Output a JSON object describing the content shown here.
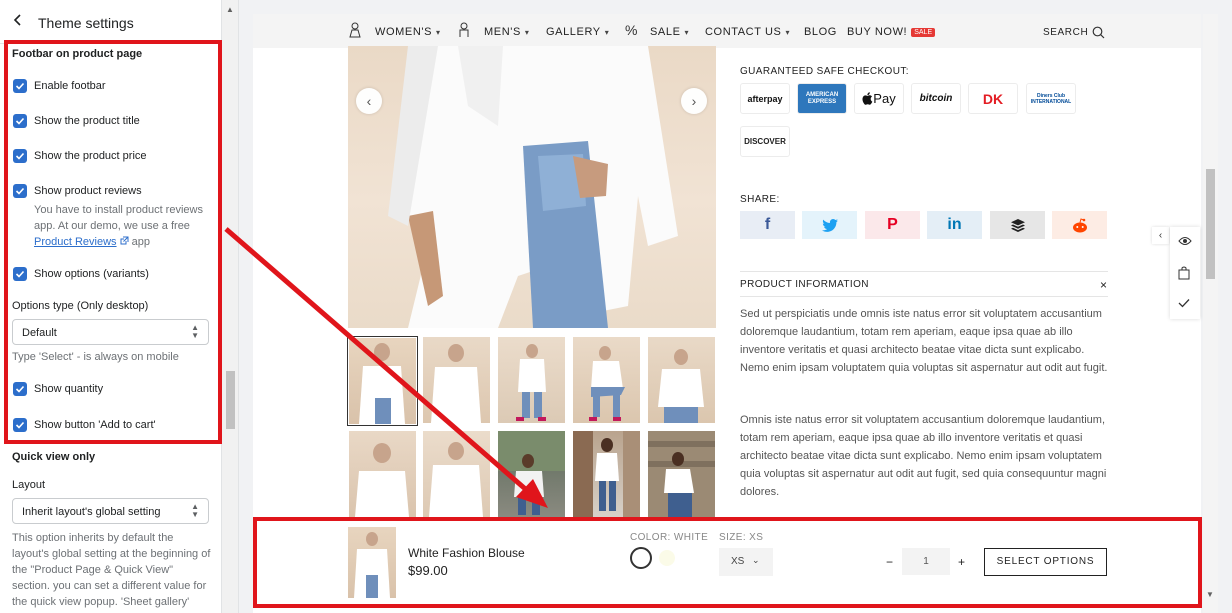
{
  "panel": {
    "back_icon": "chevron-left-icon",
    "title": "Theme settings",
    "footbar_section_title": "Footbar on product page",
    "checkboxes": {
      "enable_footbar": "Enable footbar",
      "show_title": "Show the product title",
      "show_price": "Show the product price",
      "show_reviews": "Show product reviews",
      "show_options": "Show options (variants)",
      "show_quantity": "Show quantity",
      "show_add_to_cart": "Show button 'Add to cart'"
    },
    "reviews_help_before": "You have to install product reviews app. At our demo, we use a free ",
    "reviews_help_link": "Product Reviews",
    "reviews_help_after": " app",
    "options_type_label": "Options type (Only desktop)",
    "options_type_value": "Default",
    "options_type_note": "Type 'Select' - is always on mobile",
    "quick_view_title": "Quick view only",
    "layout_label": "Layout",
    "layout_value": "Inherit layout's global setting",
    "layout_help": "This option inherits by default the layout's global setting at the beginning of the \"Product Page & Quick View\" section. you can set a different value for the quick view popup. 'Sheet gallery'"
  },
  "nav": {
    "womens": "WOMEN'S",
    "mens": "MEN'S",
    "gallery": "GALLERY",
    "sale": "SALE",
    "contact": "CONTACT US",
    "blog": "BLOG",
    "buy_now": "BUY NOW!",
    "sale_badge": "SALE",
    "search": "SEARCH"
  },
  "checkout_title": "GUARANTEED SAFE CHECKOUT:",
  "payments": [
    "afterpay",
    "AMERICAN EXPRESS",
    "Pay",
    "bitcoin",
    "DK",
    "Diners Club INTERNATIONAL",
    "DISCOVER"
  ],
  "share_title": "SHARE:",
  "share_icons": [
    "facebook-icon",
    "twitter-icon",
    "pinterest-icon",
    "linkedin-icon",
    "buffer-icon",
    "reddit-icon"
  ],
  "product_info_title": "PRODUCT INFORMATION",
  "product_info_close": "×",
  "paragraph1": "Sed ut perspiciatis unde omnis iste natus error sit voluptatem accusantium doloremque laudantium, totam rem aperiam, eaque ipsa quae ab illo inventore veritatis et quasi architecto beatae vitae dicta sunt explicabo. Nemo enim ipsam voluptatem quia voluptas sit aspernatur aut odit aut fugit.",
  "paragraph2": "Omnis iste natus error sit voluptatem accusantium doloremque laudantium, totam rem aperiam, eaque ipsa quae ab illo inventore veritatis et quasi architecto beatae vitae dicta sunt explicabo. Nemo enim ipsam voluptatem quia voluptas sit aspernatur aut odit aut fugit, sed quia consequuntur magni dolores.",
  "footbar": {
    "product_title": "White Fashion Blouse",
    "price": "$99.00",
    "color_label": "COLOR: WHITE",
    "size_label": "SIZE: XS",
    "size_value": "XS",
    "qty_minus": "−",
    "qty_value": "1",
    "qty_plus": "+",
    "button": "SELECT OPTIONS"
  },
  "colors": {
    "accent": "#2c6ecb",
    "annotation_red": "#e0151b"
  }
}
